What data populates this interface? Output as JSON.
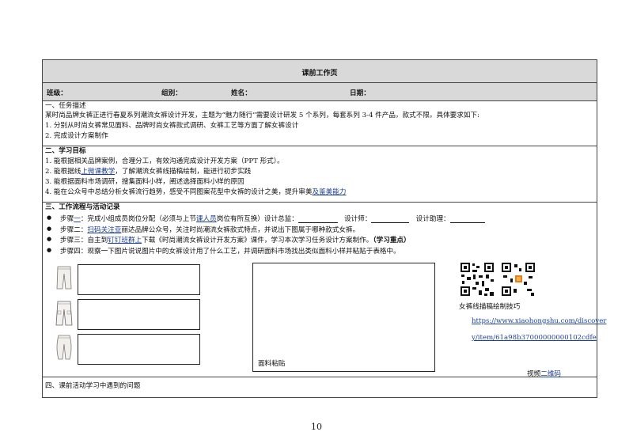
{
  "title": "课前工作页",
  "info": {
    "class": "班级：",
    "group": "组别：",
    "name": "姓名：",
    "date": "日期："
  },
  "task": {
    "heading": "一、任务描述",
    "desc": "某时尚品牌女裤正进行春夏系列潮流女裤设计开发，主题为“魅力随行”需要设计研发 5 个系列，每套系列 3-4 件产品，款式不限。具体要求如下:",
    "items": [
      "1.  分别从时尚女裤常见面料、品牌时尚女裤款式调研、女裤工艺等方面了解女裤设计",
      "2.  完成设计方案制作"
    ]
  },
  "goals": {
    "heading": "二、学习目标",
    "item1": "1.  能根据相关品牌案例，合理分工，有效沟通完成设计开发方案（PPT 形式）。",
    "item2_a": "2.  能根据线",
    "item2_hl": "上微课教学",
    "item2_b": "，了解潮流女裤线描稿绘制，能进行初步实践",
    "item3": "3.  能根据面料市场调研，搜集面料小样，阐述选择面料小样的原因",
    "item4_a": "4.  能在公众号中总结分析女裤流行趋势，感受不同图案花型中女裤的设计之美，提升审美",
    "item4_hl": "及鉴美能力"
  },
  "process": {
    "heading": "三、工作流程与活动记录",
    "step1_a": "步骤",
    "step1_hl": "一",
    "step1_b": "：完成小组成员岗位分配（必须与上节",
    "step1_hl2": "课人员",
    "step1_c": "岗位有所互换）设计总监：",
    "step1_d": "设计师：",
    "step1_e": "设计助理：",
    "step2_a": "步骤二：",
    "step2_hl": "扫码关注亚",
    "step2_b": "丽达品牌公众号，关注时尚潮流女裤款式特点，并说出下图属于哪种款式女裤。",
    "step3_a": "步骤三：自主到",
    "step3_hl": "钉钉班群上",
    "step3_b": "下载《时尚潮流女裤设计开发方案》课件，学习本次学习任务设计方案制作。",
    "step3_c": "（学习重点）",
    "step4": "步骤四：观察一下图片说说图片中的女裤设计用了什么工艺，并调研面料市场找出类似面料小样并粘贴于表格中。",
    "fabric_label": "面料粘贴",
    "qr_caption": "女裤线描稿绘制技巧",
    "link_line1": "https://www.xiaohongshu.com/discover",
    "link_line2": "y/item/61a98b37000000000102cdfe",
    "video_a": "视频",
    "video_hl": "二维码"
  },
  "issues": {
    "heading": "四、课前活动学习中遇到的问题"
  },
  "page_number": "10"
}
